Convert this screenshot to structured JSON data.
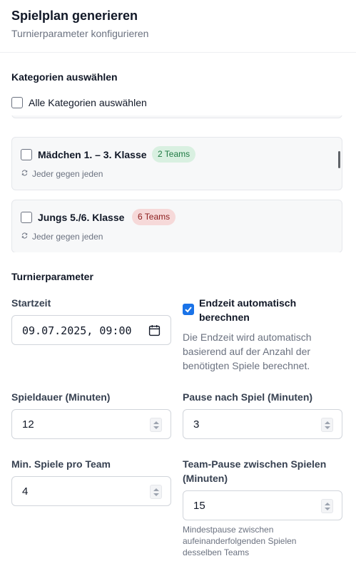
{
  "header": {
    "title": "Spielplan generieren",
    "subtitle": "Turnierparameter konfigurieren"
  },
  "categories": {
    "section_label": "Kategorien auswählen",
    "select_all_label": "Alle Kategorien auswählen",
    "select_all_checked": false,
    "items": [
      {
        "name": "Mädchen 1. – 3. Klasse",
        "badge": "2 Teams",
        "badge_color": "#1f7a43",
        "mode": "Jeder gegen jeden",
        "checked": false
      },
      {
        "name": "Jungs 5./6. Klasse",
        "badge": "6 Teams",
        "badge_color": "#8b1c1c",
        "mode": "Jeder gegen jeden",
        "checked": false
      }
    ]
  },
  "params": {
    "section_label": "Turnierparameter",
    "start": {
      "label": "Startzeit",
      "value": "09.07.2025, 09:00"
    },
    "auto_end": {
      "label": "Endzeit automatisch berechnen",
      "checked": true,
      "help": "Die Endzeit wird automatisch basierend auf der Anzahl der benötigten Spiele berechnet."
    },
    "duration": {
      "label": "Spieldauer (Minuten)",
      "value": "12"
    },
    "pause": {
      "label": "Pause nach Spiel (Minuten)",
      "value": "3"
    },
    "min_games": {
      "label": "Min. Spiele pro Team",
      "value": "4"
    },
    "team_pause": {
      "label": "Team-Pause zwischen Spielen (Minuten)",
      "value": "15",
      "help": "Mindestpause zwischen aufeinanderfolgenden Spielen desselben Teams"
    }
  },
  "colors": {
    "accent": "#1a73e8"
  }
}
